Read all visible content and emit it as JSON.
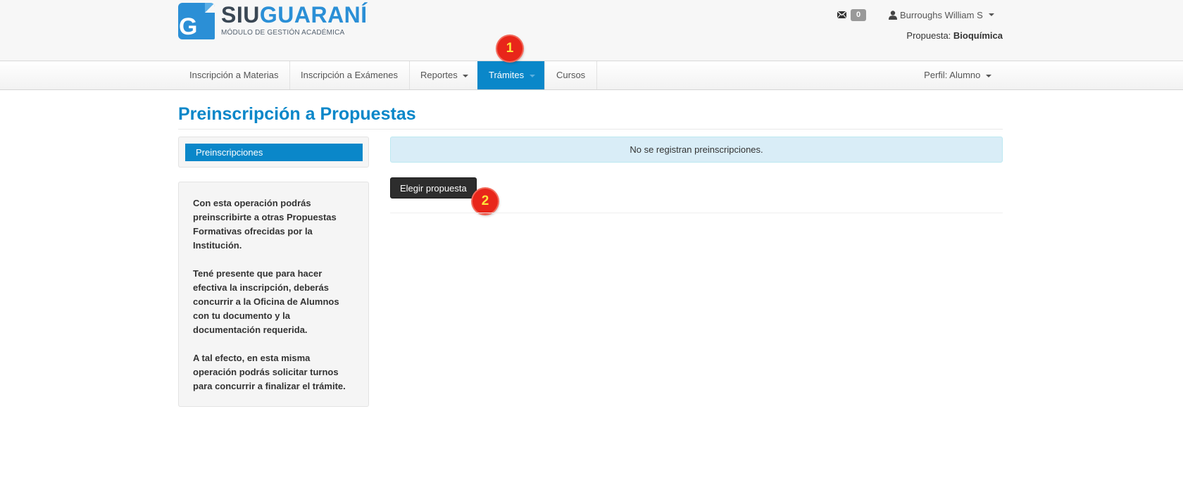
{
  "header": {
    "logo": {
      "siu": "SIU",
      "guarani": "GUARANÍ",
      "subtitle": "MÓDULO DE GESTIÓN ACADÉMICA",
      "icon_letter": "G"
    },
    "messages": {
      "icon": "envelope-icon",
      "count": "0"
    },
    "user": {
      "icon": "user-icon",
      "name": "Burroughs William S"
    },
    "propuesta": {
      "label": "Propuesta:",
      "value": "Bioquímica"
    }
  },
  "nav": {
    "items": [
      {
        "label": "Inscripción a Materias"
      },
      {
        "label": "Inscripción a Exámenes"
      },
      {
        "label": "Reportes"
      },
      {
        "label": "Trámites"
      },
      {
        "label": "Cursos"
      }
    ],
    "perfil": "Perfil: Alumno",
    "active_index": 3
  },
  "markers": {
    "one": "1",
    "two": "2"
  },
  "page": {
    "title": "Preinscripción a Propuestas",
    "sidebar": {
      "nav_item": "Preinscripciones",
      "info": [
        "Con esta operación podrás preinscribirte a otras Propuestas Formativas ofrecidas por la Institución.",
        "Tené presente que para hacer efectiva la inscripción, deberás concurrir a la Oficina de Alumnos con tu documento y la documentación requerida.",
        "A tal efecto, en esta misma operación podrás solicitar turnos para concurrir a finalizar el trámite."
      ]
    },
    "alert": "No se registran preinscripciones.",
    "button": "Elegir propuesta"
  },
  "colors": {
    "brand_blue": "#0a87c9",
    "logo_dark": "#3a4754",
    "alert_bg": "#d9edf7",
    "marker_red": "#e8261a",
    "marker_text": "#ffe53a",
    "button_dark": "#2d2d2d"
  }
}
